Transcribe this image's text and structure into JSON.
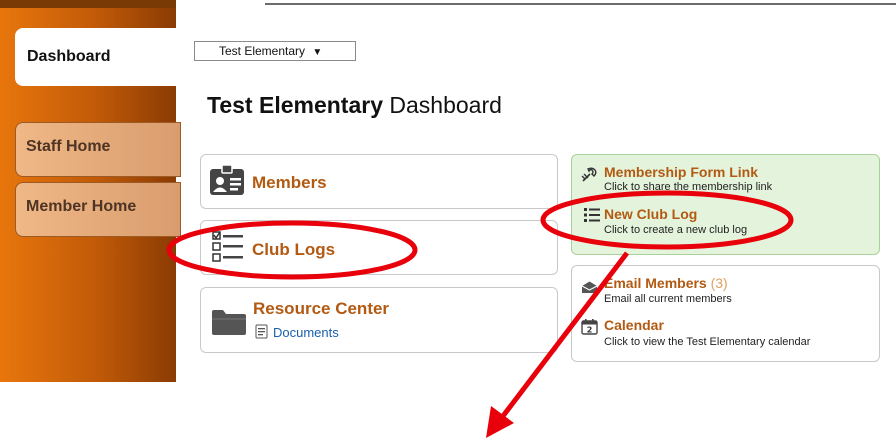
{
  "sidebar": {
    "tabs": [
      {
        "label": "Dashboard"
      },
      {
        "label": "Staff Home"
      },
      {
        "label": "Member Home"
      }
    ]
  },
  "school_select": {
    "value": "Test Elementary",
    "arrow": "▼"
  },
  "page": {
    "title_bold": "Test Elementary",
    "title_rest": "Dashboard"
  },
  "cards": {
    "members": {
      "title": "Members",
      "icon": "id-card-icon"
    },
    "club_logs": {
      "title": "Club Logs",
      "icon": "checklist-icon"
    },
    "resource_center": {
      "title": "Resource Center",
      "link": "Documents",
      "icon": "folder-icon"
    }
  },
  "actions": {
    "membership_form": {
      "title": "Membership Form Link",
      "desc": "Click to share the membership link",
      "icon": "link-icon"
    },
    "new_club_log": {
      "title": "New Club Log",
      "desc": "Click to create a new club log",
      "icon": "list-icon"
    },
    "email_members": {
      "title": "Email Members",
      "count": "(3)",
      "desc": "Email all current members",
      "icon": "envelope-icon"
    },
    "calendar": {
      "title": "Calendar",
      "desc": "Click to view the Test Elementary calendar",
      "icon": "calendar-icon"
    }
  },
  "annotation": {
    "color": "#e8000b"
  }
}
